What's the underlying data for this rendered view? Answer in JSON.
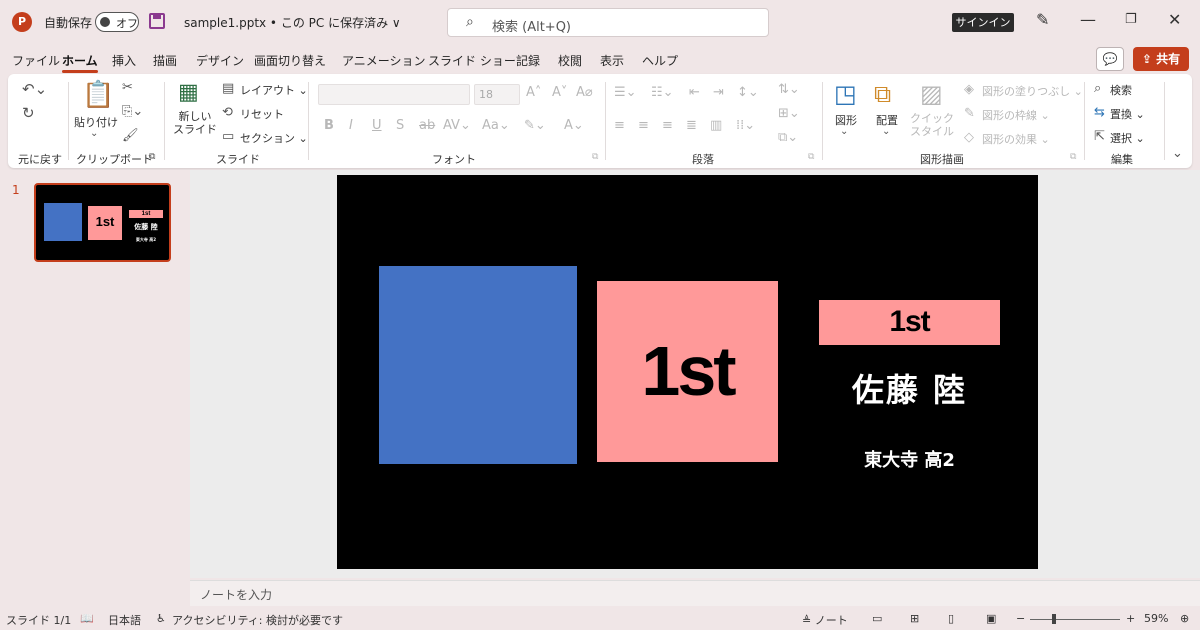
{
  "titlebar": {
    "app_icon": "P",
    "autosave_label": "自動保存",
    "autosave_state": "オフ",
    "doc_title": "sample1.pptx • この PC に保存済み ∨",
    "search_placeholder": "検索 (Alt+Q)",
    "signin_label": "サインイン"
  },
  "menu": {
    "tabs": [
      "ファイル",
      "ホーム",
      "挿入",
      "描画",
      "デザイン",
      "画面切り替え",
      "アニメーション",
      "スライド ショー",
      "記録",
      "校閲",
      "表示",
      "ヘルプ"
    ],
    "active_tab": "ホーム",
    "share_label": "共有"
  },
  "ribbon": {
    "groups": {
      "undo": "元に戻す",
      "clipboard": "クリップボード",
      "slides": "スライド",
      "font": "フォント",
      "paragraph": "段落",
      "drawing": "図形描画",
      "editing": "編集"
    },
    "paste_label": "貼り付け",
    "new_slide_label": "新しい\nスライド",
    "layout_label": "レイアウト",
    "reset_label": "リセット",
    "section_label": "セクション",
    "font_size": "18",
    "shapes_label": "図形",
    "arrange_label": "配置",
    "quick_style_label": "クイック\nスタイル",
    "shape_fill_label": "図形の塗りつぶし",
    "shape_outline_label": "図形の枠線",
    "shape_effect_label": "図形の効果",
    "find_label": "検索",
    "replace_label": "置換",
    "select_label": "選択"
  },
  "thumbnails": {
    "number": "1"
  },
  "slide": {
    "pink_box_text": "1st",
    "banner_text": "1st",
    "name": "佐藤 陸",
    "school": "東大寺 高2",
    "colors": {
      "blue": "#4472c4",
      "pink": "#ff9999",
      "background": "#000000"
    }
  },
  "notes_placeholder": "ノートを入力",
  "status": {
    "slide_count": "スライド 1/1",
    "language": "日本語",
    "accessibility": "アクセシビリティ: 検討が必要です",
    "notes_button": "ノート",
    "zoom": "59%"
  }
}
